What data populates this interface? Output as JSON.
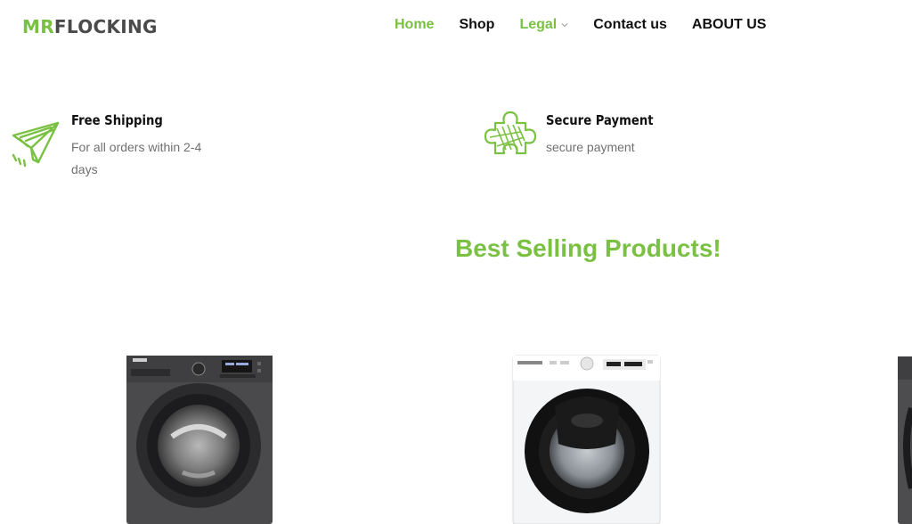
{
  "brand": {
    "part1": "MR",
    "part2": "FLOCKING"
  },
  "nav": [
    {
      "label": "Home"
    },
    {
      "label": "Shop"
    },
    {
      "label": "Legal"
    },
    {
      "label": "Contact us"
    },
    {
      "label": "ABOUT US"
    }
  ],
  "features": [
    {
      "title": "Free Shipping",
      "description": "For all orders within 2-4 days",
      "icon": "paper-plane-icon"
    },
    {
      "title": "Secure Payment",
      "description": "secure payment",
      "icon": "puzzle-piece-icon"
    }
  ],
  "section": {
    "title": "Best Selling Products!"
  },
  "products": [
    {
      "image": "washing-machine-dark-image"
    },
    {
      "image": "washing-machine-white-image"
    },
    {
      "image": "washing-machine-partial-image"
    }
  ],
  "colors": {
    "accent": "#7ac143",
    "text": "#111111",
    "muted": "#707070",
    "logo_dark": "#4a4a4a"
  }
}
